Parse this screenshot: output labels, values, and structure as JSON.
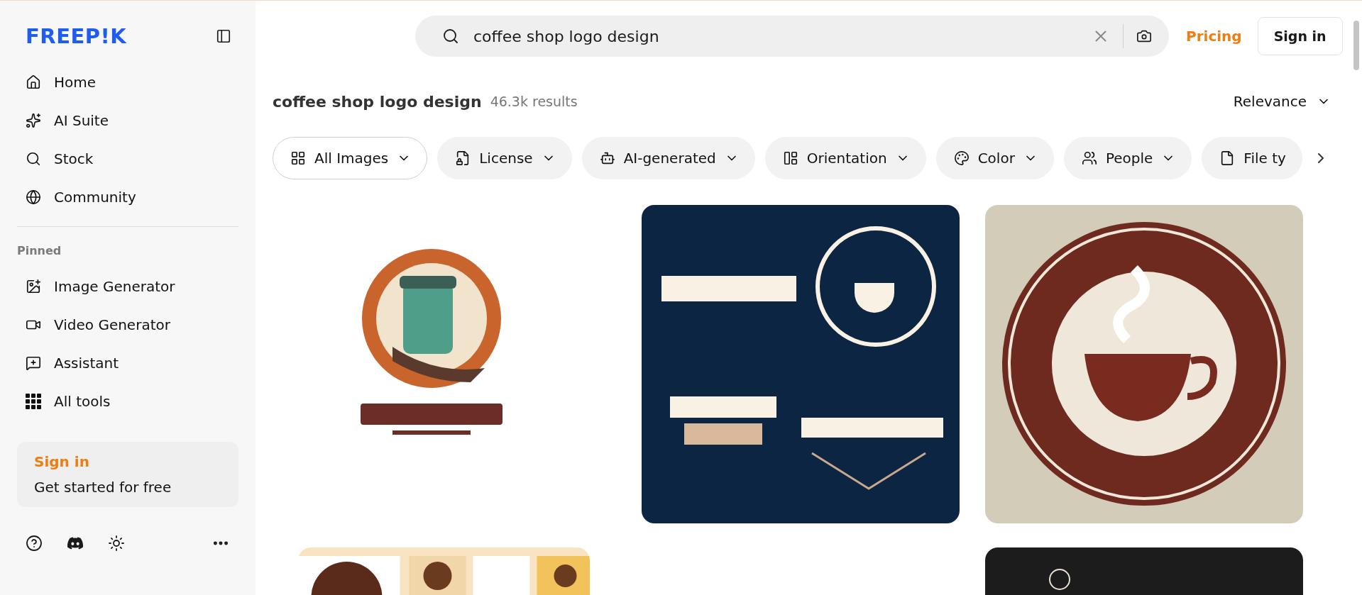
{
  "sidebar": {
    "logo": "FREEP!K",
    "nav": [
      {
        "label": "Home"
      },
      {
        "label": "AI Suite"
      },
      {
        "label": "Stock"
      },
      {
        "label": "Community"
      }
    ],
    "pinned_heading": "Pinned",
    "pinned": [
      {
        "label": "Image Generator"
      },
      {
        "label": "Video Generator"
      },
      {
        "label": "Assistant"
      },
      {
        "label": "All tools"
      }
    ],
    "signin_card": {
      "link": "Sign in",
      "text": "Get started for free"
    }
  },
  "topbar": {
    "search": {
      "value": "coffee shop logo design"
    },
    "pricing": "Pricing",
    "signin": "Sign in"
  },
  "results": {
    "query": "coffee shop logo design",
    "count": "46.3k results",
    "sort": "Relevance"
  },
  "filters": [
    {
      "label": "All Images",
      "selected": true
    },
    {
      "label": "License",
      "selected": false
    },
    {
      "label": "AI-generated",
      "selected": false
    },
    {
      "label": "Orientation",
      "selected": false
    },
    {
      "label": "Color",
      "selected": false
    },
    {
      "label": "People",
      "selected": false
    },
    {
      "label": "File ty",
      "selected": false
    }
  ]
}
